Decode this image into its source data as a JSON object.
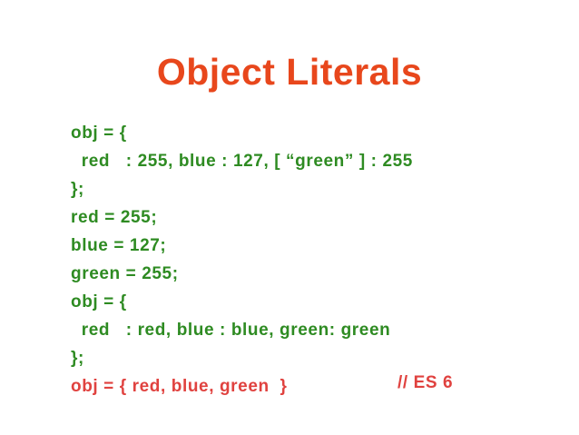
{
  "slide": {
    "title": "Object Literals",
    "code_lines": [
      "obj = {",
      "  red   : 255, blue : 127, [ “green” ] : 255",
      "};",
      "red = 255;",
      "blue = 127;",
      "green = 255;",
      "obj = {",
      "  red   : red, blue : blue, green: green",
      "};",
      "obj = { red, blue, green  }"
    ],
    "comment": "// ES 6"
  },
  "colors": {
    "title": "#e8471c",
    "code": "#2e8b22",
    "highlight": "#e0423f",
    "background": "#ffffff"
  }
}
